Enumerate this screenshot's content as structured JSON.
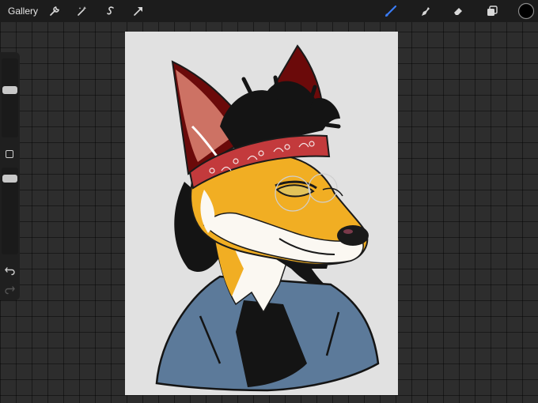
{
  "app": {
    "gallery_label": "Gallery"
  },
  "toolbar": {
    "left_tools": [
      "actions-wrench-icon",
      "adjustments-wand-icon",
      "selection-s-icon",
      "transform-arrow-icon"
    ],
    "right_tools": [
      "brush-icon",
      "smudge-icon",
      "eraser-icon",
      "layers-icon"
    ],
    "active_tool": "brush-icon",
    "accent_color": "#3a7cf5",
    "current_color": "#000000"
  },
  "sidebar": {
    "brush_size_level": 0.72,
    "opacity_level": 0.68,
    "undo_icon": "undo-icon",
    "redo_icon": "redo-icon"
  },
  "colors": {
    "canvas_bg": "#e1e1e1",
    "ear_red": "#6b0a0a",
    "ear_inner": "#cd7264",
    "fur_orange": "#f1ae23",
    "fur_white": "#fbf8f2",
    "bandana_red": "#c33a3c",
    "jacket_blue": "#5c7a9a",
    "hair_black": "#141414"
  }
}
